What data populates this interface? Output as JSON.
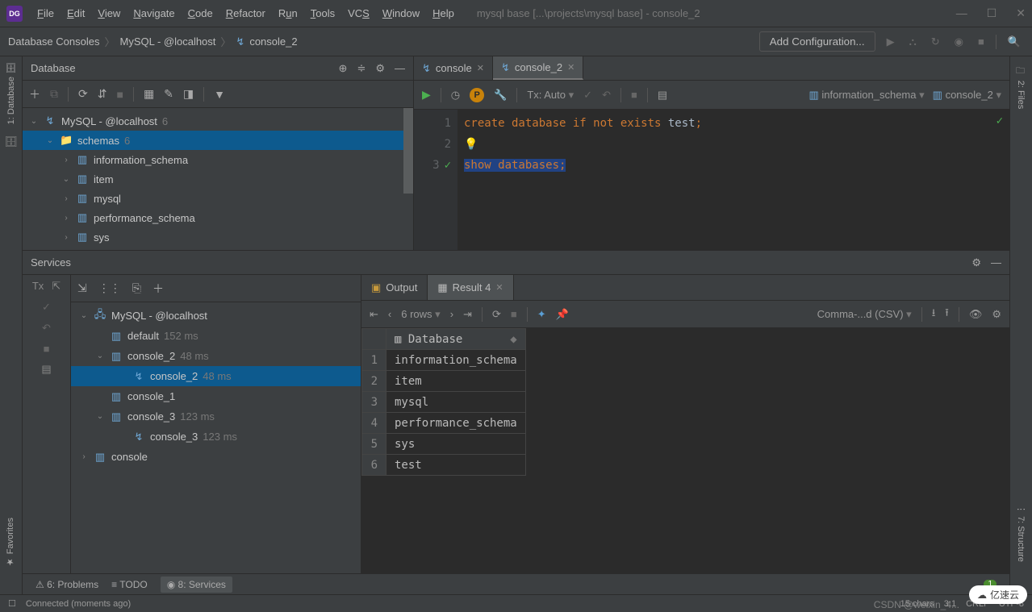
{
  "window": {
    "title": "mysql base [...\\projects\\mysql base] - console_2",
    "menu": [
      "File",
      "Edit",
      "View",
      "Navigate",
      "Code",
      "Refactor",
      "Run",
      "Tools",
      "VCS",
      "Window",
      "Help"
    ]
  },
  "breadcrumb": {
    "a": "Database Consoles",
    "b": "MySQL - @localhost",
    "c": "console_2"
  },
  "add_config": "Add Configuration...",
  "database_panel": {
    "title": "Database",
    "ds": {
      "name": "MySQL - @localhost",
      "badge": "6"
    },
    "schemas_label": "schemas",
    "schemas_count": "6",
    "schemas": [
      {
        "name": "information_schema",
        "exp": "›"
      },
      {
        "name": "item",
        "exp": "⌄"
      },
      {
        "name": "mysql",
        "exp": "›"
      },
      {
        "name": "performance_schema",
        "exp": "›"
      },
      {
        "name": "sys",
        "exp": "›"
      }
    ]
  },
  "editor": {
    "tabs": [
      {
        "label": "console",
        "active": false
      },
      {
        "label": "console_2",
        "active": true
      }
    ],
    "tx": "Tx: Auto",
    "schema_sel": "information_schema",
    "console_sel": "console_2",
    "code": {
      "l1_kw": "create database if not exists",
      "l1_id": "test",
      "l1_punc": ";",
      "l3_kw": "show databases",
      "l3_punc": ";"
    }
  },
  "services": {
    "title": "Services",
    "tx_icon": "Tx",
    "tree": [
      {
        "indent": 10,
        "exp": "⌄",
        "ic": "🖧",
        "name": "MySQL - @localhost",
        "meta": ""
      },
      {
        "indent": 30,
        "exp": "",
        "ic": "▥",
        "name": "default",
        "meta": "152 ms"
      },
      {
        "indent": 30,
        "exp": "⌄",
        "ic": "▥",
        "name": "console_2",
        "meta": "48 ms"
      },
      {
        "indent": 58,
        "exp": "",
        "ic": "↯",
        "name": "console_2",
        "meta": "48 ms",
        "sel": true
      },
      {
        "indent": 30,
        "exp": "",
        "ic": "▥",
        "name": "console_1",
        "meta": ""
      },
      {
        "indent": 30,
        "exp": "⌄",
        "ic": "▥",
        "name": "console_3",
        "meta": "123 ms"
      },
      {
        "indent": 58,
        "exp": "",
        "ic": "↯",
        "name": "console_3",
        "meta": "123 ms"
      },
      {
        "indent": 10,
        "exp": "›",
        "ic": "▥",
        "name": "console",
        "meta": ""
      }
    ],
    "result_tabs": {
      "output": "Output",
      "result": "Result 4"
    },
    "rows_label": "6 rows",
    "export_fmt": "Comma-...d (CSV)",
    "grid": {
      "header": "Database",
      "rows": [
        "information_schema",
        "item",
        "mysql",
        "performance_schema",
        "sys",
        "test"
      ]
    }
  },
  "bottom_tabs": {
    "problems": "6: Problems",
    "todo": "TODO",
    "services": "8: Services"
  },
  "status": {
    "conn": "Connected (moments ago)",
    "chars": "15 chars",
    "pos": "3:1",
    "eol": "CRLF",
    "enc": "UTF-8",
    "badge": "1"
  },
  "sidebar_left": {
    "database": "1: Database",
    "favorites": "Favorites"
  },
  "sidebar_right": {
    "files": "2: Files",
    "structure": "7: Structure"
  },
  "watermark": "CSDN @weixin_4...",
  "ys": "亿速云"
}
